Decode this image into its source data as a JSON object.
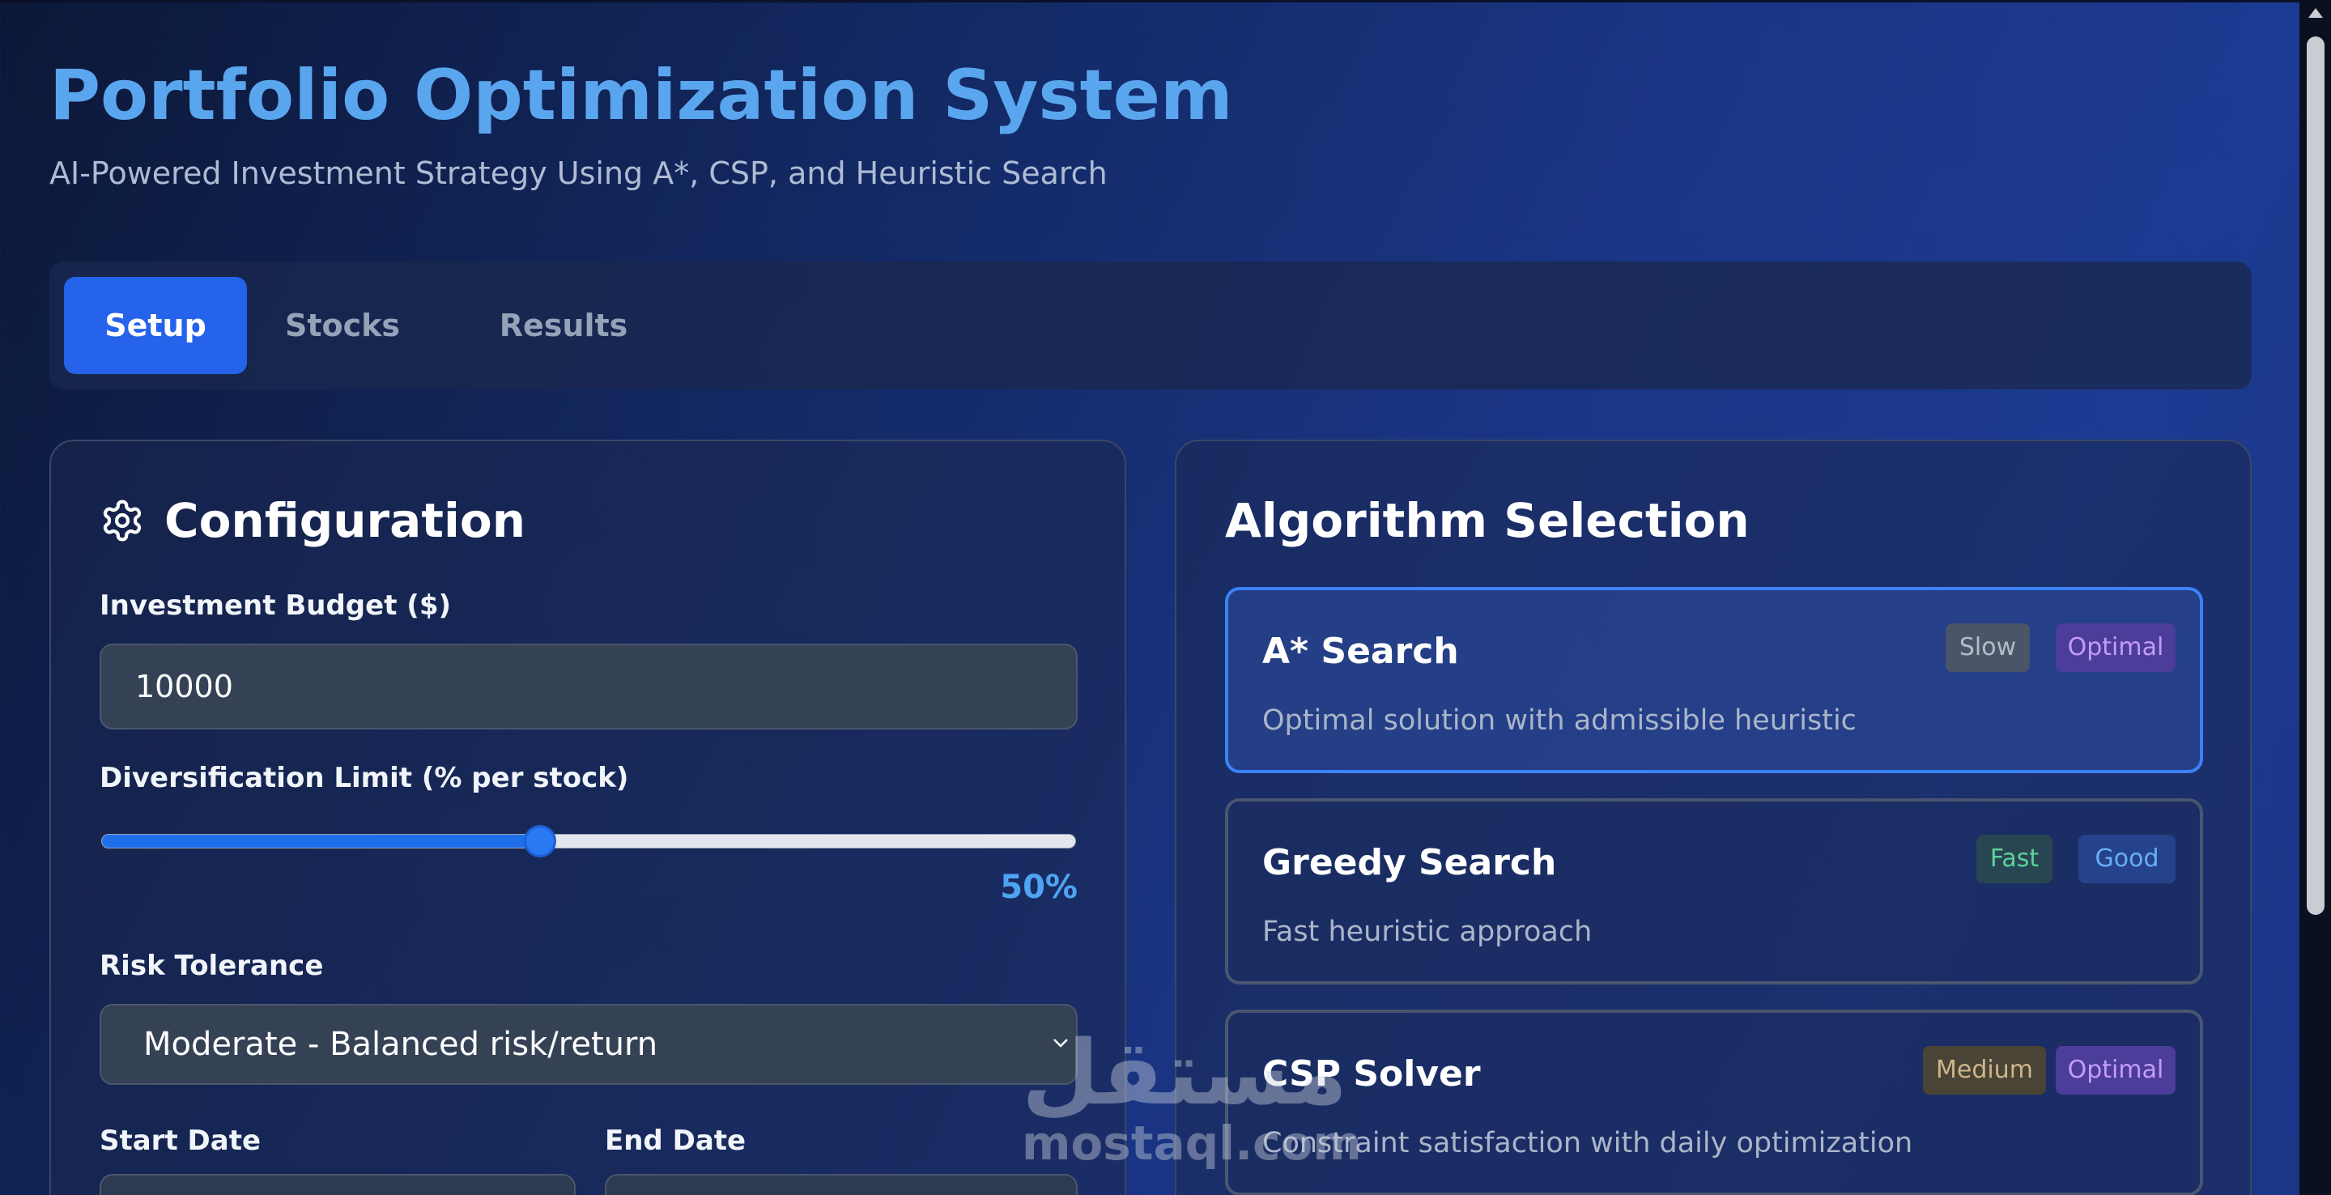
{
  "header": {
    "title": "Portfolio Optimization System",
    "subtitle": "AI-Powered Investment Strategy Using A*, CSP, and Heuristic Search"
  },
  "tabs": [
    {
      "label": "Setup",
      "active": true
    },
    {
      "label": "Stocks",
      "active": false
    },
    {
      "label": "Results",
      "active": false
    }
  ],
  "configuration": {
    "heading": "Configuration",
    "icon": "gear-icon",
    "budget_label": "Investment Budget ($)",
    "budget_value": "10000",
    "diversification_label": "Diversification Limit (% per stock)",
    "diversification_value": 50,
    "diversification_display": "50%",
    "risk_label": "Risk Tolerance",
    "risk_value": "Moderate - Balanced risk/return",
    "start_date_label": "Start Date",
    "end_date_label": "End Date"
  },
  "algorithm_selection": {
    "heading": "Algorithm Selection",
    "options": [
      {
        "name": "A* Search",
        "description": "Optimal solution with admissible heuristic",
        "badges": [
          "Slow",
          "Optimal"
        ],
        "selected": true
      },
      {
        "name": "Greedy Search",
        "description": "Fast heuristic approach",
        "badges": [
          "Fast",
          "Good"
        ],
        "selected": false
      },
      {
        "name": "CSP Solver",
        "description": "Constraint satisfaction with daily optimization",
        "badges": [
          "Medium",
          "Optimal"
        ],
        "selected": false
      }
    ]
  },
  "watermark": {
    "arabic": "مستقل",
    "latin": "mostaql.com"
  },
  "colors": {
    "accent": "#2563eb",
    "title": "#5aa6ee",
    "selected_border": "#3b82f6"
  }
}
